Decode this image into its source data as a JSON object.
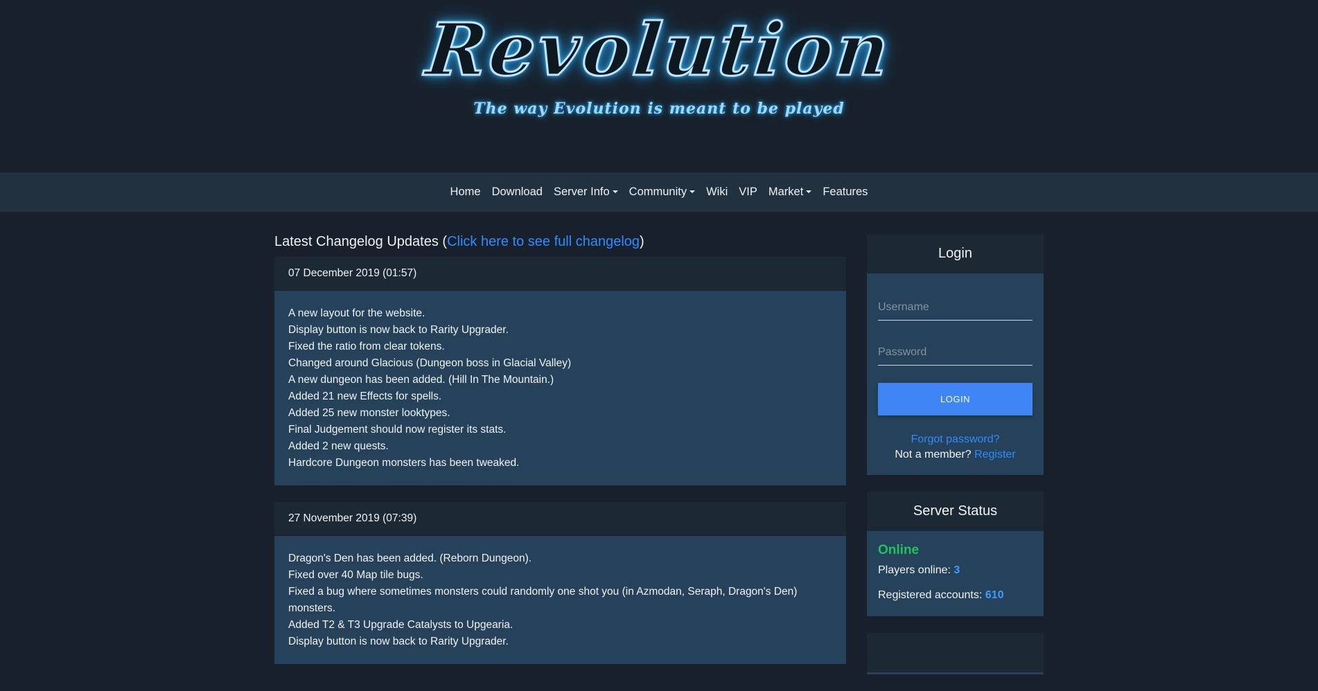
{
  "logo": {
    "title": "Revolution",
    "subtitle": "The way Evolution is meant to be played"
  },
  "nav": {
    "items": [
      {
        "label": "Home",
        "dropdown": false
      },
      {
        "label": "Download",
        "dropdown": false
      },
      {
        "label": "Server Info",
        "dropdown": true
      },
      {
        "label": "Community",
        "dropdown": true
      },
      {
        "label": "Wiki",
        "dropdown": false
      },
      {
        "label": "VIP",
        "dropdown": false
      },
      {
        "label": "Market",
        "dropdown": true
      },
      {
        "label": "Features",
        "dropdown": false
      }
    ]
  },
  "changelog": {
    "heading_prefix": "Latest Changelog Updates (",
    "heading_link": "Click here to see full changelog",
    "heading_suffix": ")",
    "entries": [
      {
        "date": "07 December 2019 (01:57)",
        "lines": [
          "A new layout for the website.",
          "Display button is now back to Rarity Upgrader.",
          "Fixed the ratio from clear tokens.",
          "Changed around Glacious (Dungeon boss in Glacial Valley)",
          "A new dungeon has been added. (Hill In The Mountain.)",
          "Added 21 new Effects for spells.",
          "Added 25 new monster looktypes.",
          "Final Judgement should now register its stats.",
          "Added 2 new quests.",
          "Hardcore Dungeon monsters has been tweaked."
        ]
      },
      {
        "date": "27 November 2019 (07:39)",
        "lines": [
          "Dragon's Den has been added. (Reborn Dungeon).",
          "Fixed over 40 Map tile bugs.",
          "Fixed a bug where sometimes monsters could randomly one shot you (in Azmodan, Seraph, Dragon's Den) monsters.",
          "Added T2 & T3 Upgrade Catalysts to Upgearia.",
          "Display button is now back to Rarity Upgrader."
        ]
      }
    ]
  },
  "login": {
    "title": "Login",
    "username_placeholder": "Username",
    "password_placeholder": "Password",
    "button_label": "LOGIN",
    "forgot_label": "Forgot password?",
    "not_member_label": "Not a member?",
    "register_label": "Register"
  },
  "server_status": {
    "title": "Server Status",
    "status": "Online",
    "players_label": "Players online:",
    "players_value": "3",
    "accounts_label": "Registered accounts:",
    "accounts_value": "610"
  },
  "colors": {
    "background": "#18212b",
    "navbar": "#223140",
    "card_body": "#26415a",
    "card_header": "#1c2935",
    "link": "#2f8cff",
    "button": "#3f86f4",
    "online": "#1ec35a"
  }
}
